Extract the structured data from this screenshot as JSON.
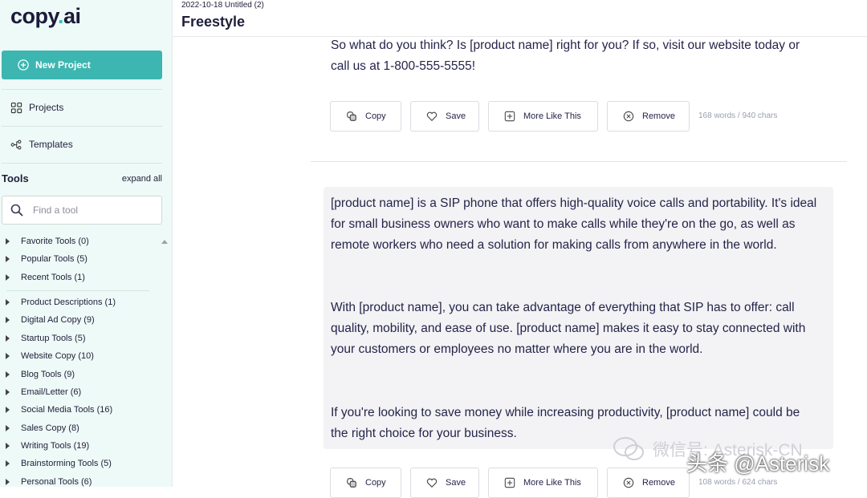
{
  "sidebar": {
    "logo_main": "copy",
    "logo_dot": ".",
    "logo_ai": "ai",
    "new_project": "New Project",
    "projects": "Projects",
    "templates": "Templates",
    "tools_heading": "Tools",
    "expand_all": "expand all",
    "find_placeholder": "Find a tool",
    "tool_items": [
      "Favorite Tools (0)",
      "Popular Tools (5)",
      "Recent Tools (1)",
      "Product Descriptions (1)",
      "Digital Ad Copy (9)",
      "Startup Tools (5)",
      "Website Copy (10)",
      "Blog Tools (9)",
      "Email/Letter (6)",
      "Social Media Tools (16)",
      "Sales Copy (8)",
      "Writing Tools (19)",
      "Brainstorming Tools (5)",
      "Personal Tools (6)"
    ]
  },
  "header": {
    "date_title": "2022-10-18 Untitled (2)",
    "title": "Freestyle"
  },
  "results": [
    {
      "paragraphs": [
        "So what do you think? Is [product name] right for you? If so, visit our website today or call us at 1-800-555-5555!"
      ],
      "count": "168 words / 940 chars"
    },
    {
      "paragraphs": [
        "[product name] is a SIP phone that offers high-quality voice calls and portability. It's ideal for small business owners who want to make calls while they're on the go, as well as remote workers who need a solution for making calls from anywhere in the world.",
        "With [product name], you can take advantage of everything that SIP has to offer: call quality, mobility, and ease of use. [product name] makes it easy to stay connected with your customers or employees no matter where you are in the world.",
        "If you're looking to save money while increasing productivity, [product name] could be the right choice for your business."
      ],
      "count": "108 words / 624 chars"
    }
  ],
  "actions": {
    "copy": "Copy",
    "save": "Save",
    "more": "More Like This",
    "remove": "Remove"
  },
  "watermark": {
    "line1": "微信号: Asterisk-CN",
    "line2": "头条 @Asterisk"
  },
  "colors": {
    "accent": "#3db6b1",
    "sidebar_bg": "#eefaf7",
    "card_bg": "#f3f3f5"
  }
}
